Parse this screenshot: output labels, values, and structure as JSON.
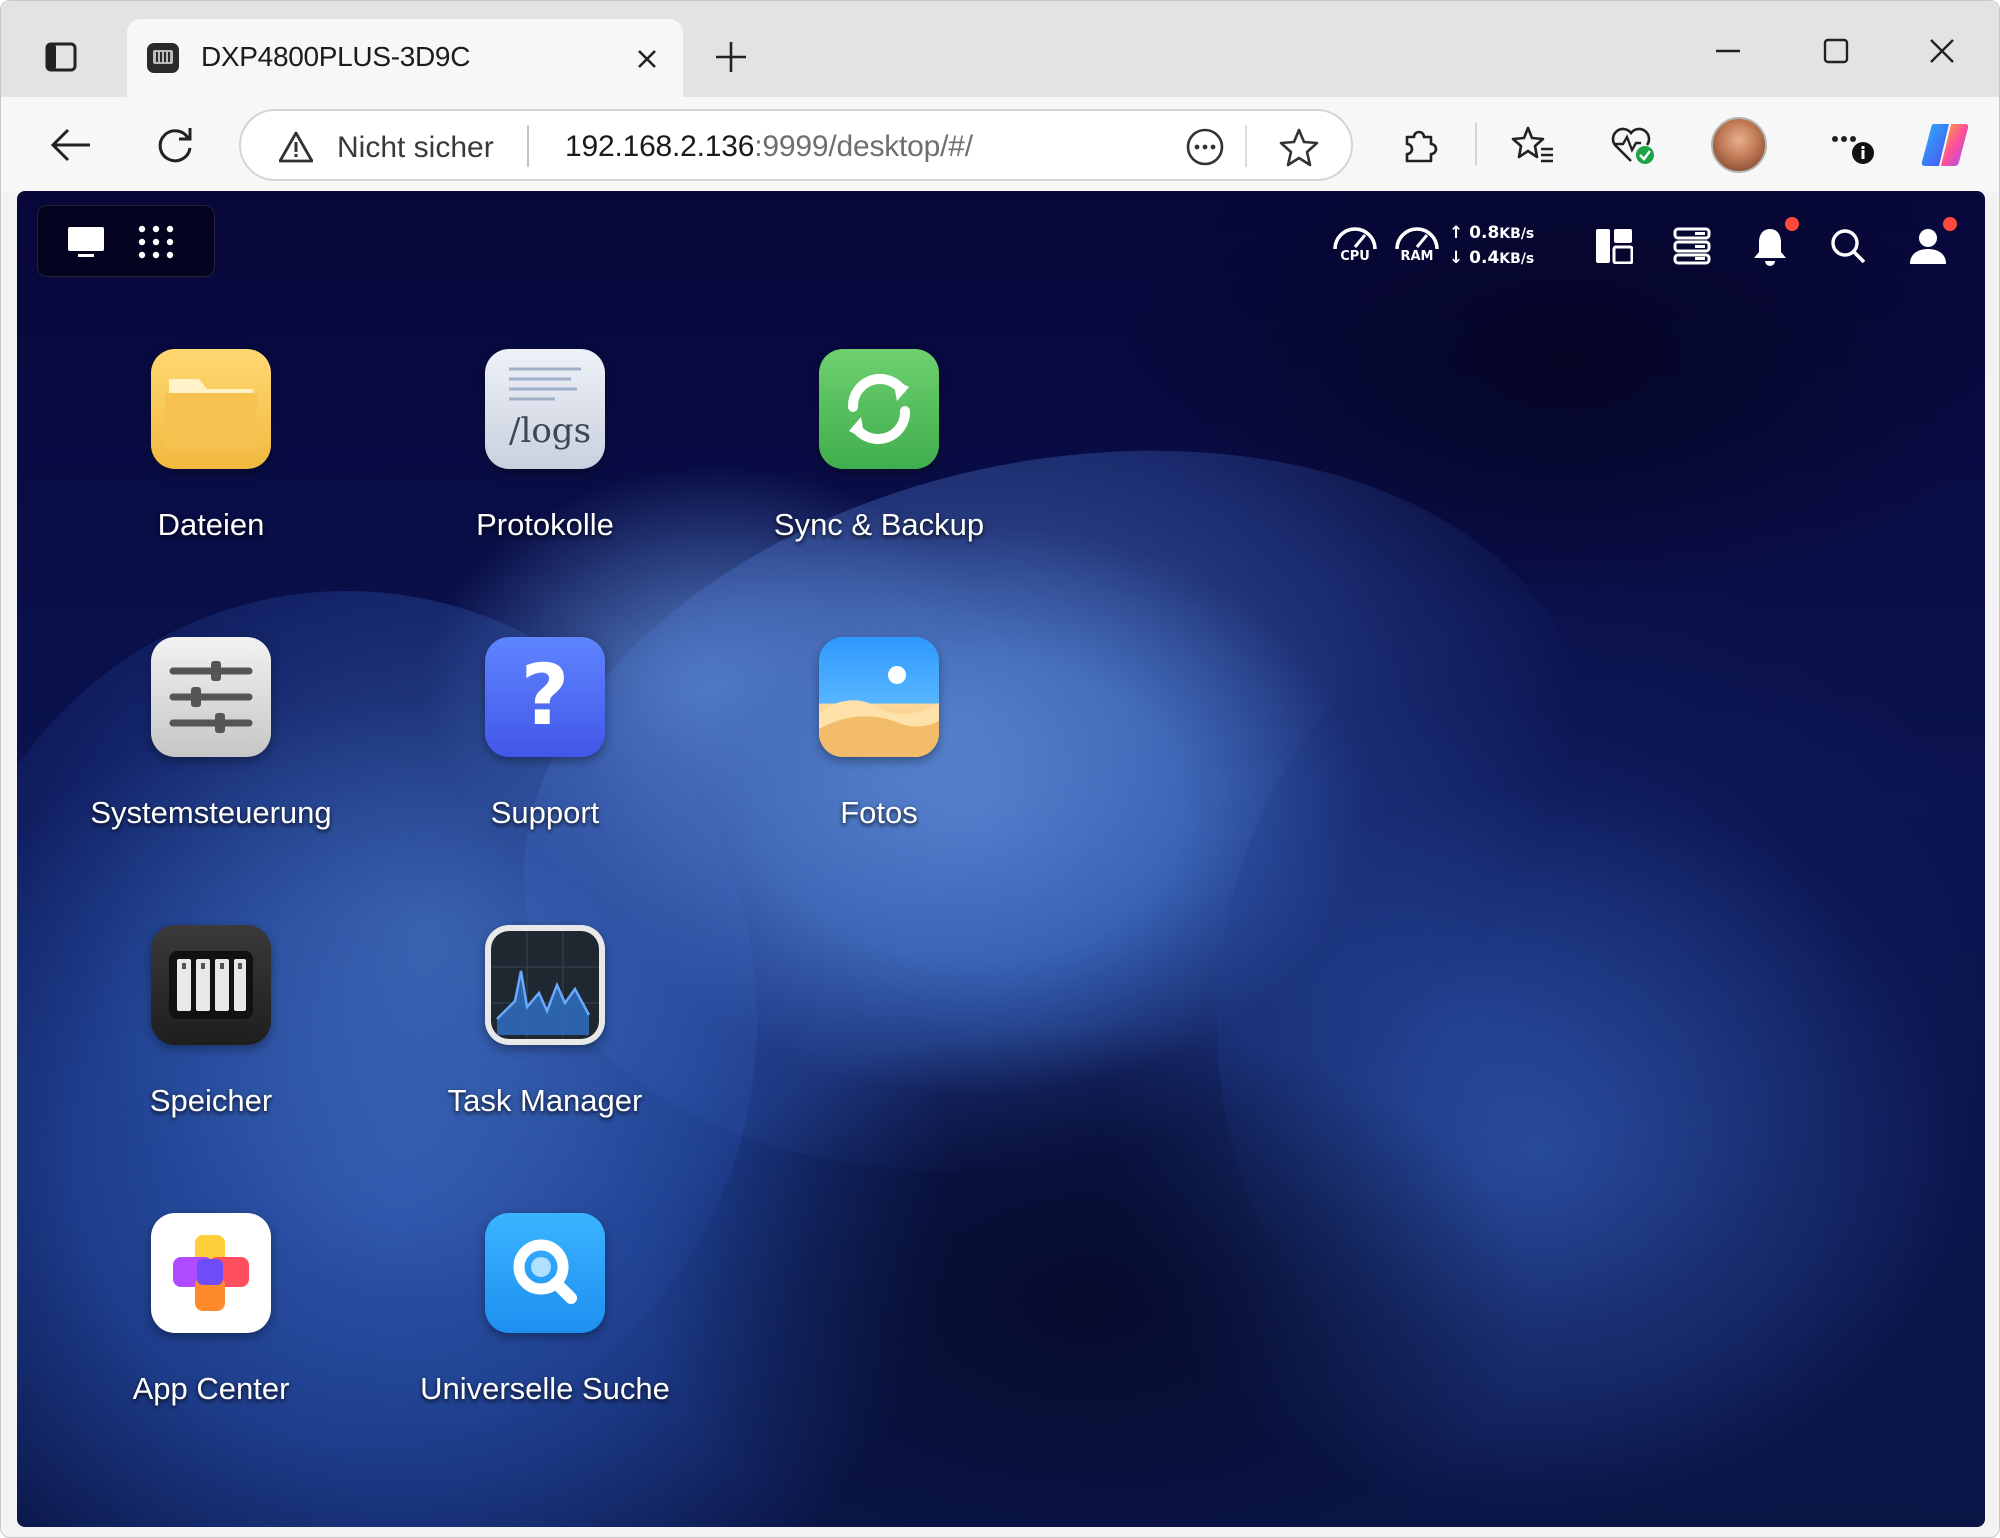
{
  "browser": {
    "tab_title": "DXP4800PLUS-3D9C",
    "security_label": "Nicht sicher",
    "url_host": "192.168.2.136",
    "url_rest": ":9999/desktop/#/"
  },
  "desktop": {
    "stats": {
      "cpu_label": "CPU",
      "ram_label": "RAM",
      "upload": "0.8",
      "download": "0.4",
      "rate_unit": "KB/s"
    },
    "apps": [
      {
        "label": "Dateien",
        "icon": "folder-icon"
      },
      {
        "label": "Protokolle",
        "icon": "logs-icon",
        "icon_text": "/logs"
      },
      {
        "label": "Sync & Backup",
        "icon": "sync-icon"
      },
      {
        "label": "Systemsteuerung",
        "icon": "sliders-icon"
      },
      {
        "label": "Support",
        "icon": "question-icon",
        "icon_text": "?"
      },
      {
        "label": "Fotos",
        "icon": "photo-icon"
      },
      {
        "label": "Speicher",
        "icon": "storage-icon"
      },
      {
        "label": "Task Manager",
        "icon": "chart-icon"
      },
      {
        "label": "App Center",
        "icon": "app-center-icon"
      },
      {
        "label": "Universelle Suche",
        "icon": "search-app-icon"
      }
    ]
  },
  "colors": {
    "desktop_bg": "#0b1350",
    "notification_dot": "#ff4b3a",
    "sync_green": "#4cba55",
    "support_blue": "#4f6ff0"
  }
}
